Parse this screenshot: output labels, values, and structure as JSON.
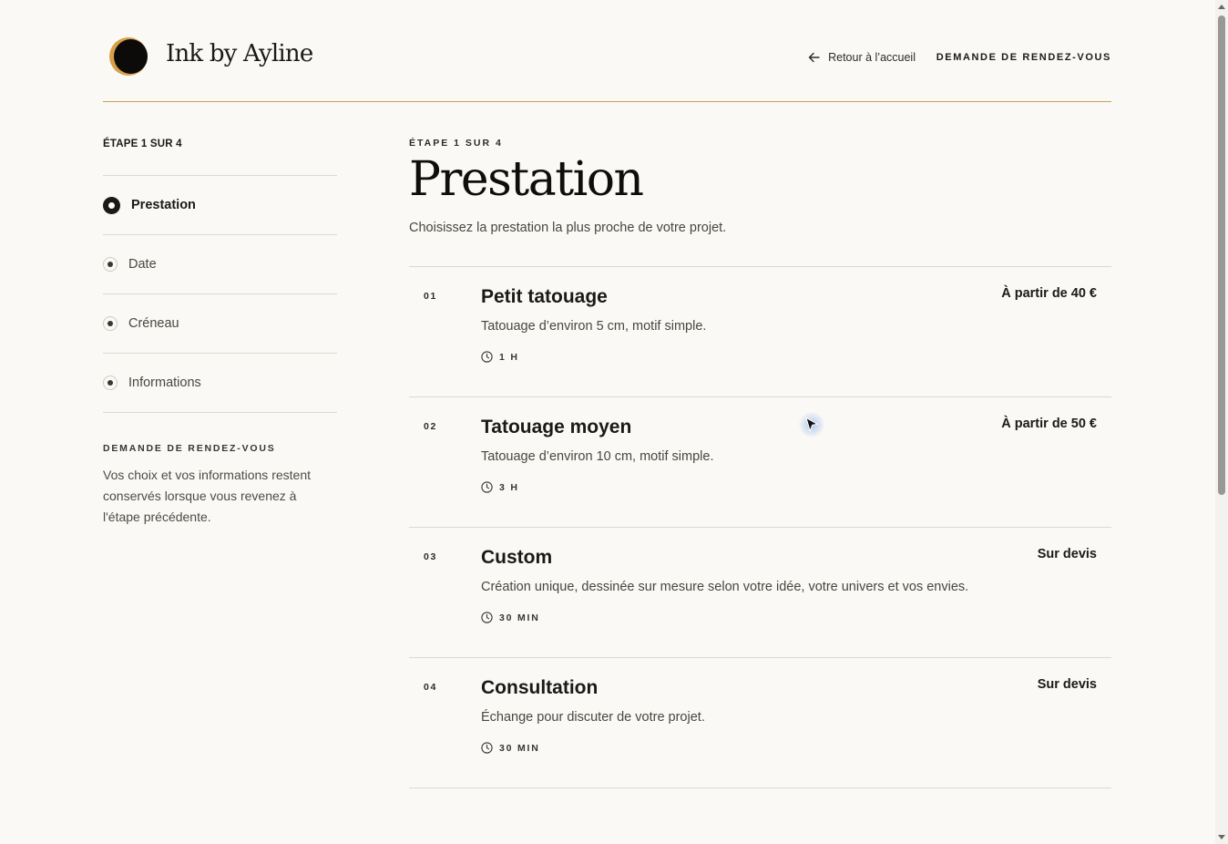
{
  "header": {
    "brand": "Ink by Ayline",
    "back_label": "Retour à l’accueil",
    "cta_label": "DEMANDE DE RENDEZ-VOUS"
  },
  "sidebar": {
    "step_label": "ÉTAPE 1 SUR 4",
    "steps": [
      {
        "label": "Prestation",
        "active": true
      },
      {
        "label": "Date",
        "active": false
      },
      {
        "label": "Créneau",
        "active": false
      },
      {
        "label": "Informations",
        "active": false
      }
    ],
    "note_title": "DEMANDE DE RENDEZ-VOUS",
    "note_text": "Vos choix et vos informations restent conservés lorsque vous revenez à l'étape précédente."
  },
  "main": {
    "step_label": "ÉTAPE 1 SUR 4",
    "title": "Prestation",
    "subtitle": "Choisissez la prestation la plus proche de votre projet.",
    "services": [
      {
        "num": "01",
        "name": "Petit tatouage",
        "desc": "Tatouage d’environ 5 cm, motif simple.",
        "duration": "1 H",
        "price": "À partir de 40 €"
      },
      {
        "num": "02",
        "name": "Tatouage moyen",
        "desc": "Tatouage d’environ 10 cm, motif simple.",
        "duration": "3 H",
        "price": "À partir de 50 €"
      },
      {
        "num": "03",
        "name": "Custom",
        "desc": "Création unique, dessinée sur mesure selon votre idée, votre univers et vos envies.",
        "duration": "30 MIN",
        "price": "Sur devis"
      },
      {
        "num": "04",
        "name": "Consultation",
        "desc": "Échange pour discuter de votre projet.",
        "duration": "30 MIN",
        "price": "Sur devis"
      }
    ]
  },
  "colors": {
    "accent": "#c9a05a",
    "logo_ring": "#d9a04a",
    "text": "#1c1a17",
    "background": "#faf9f6"
  }
}
